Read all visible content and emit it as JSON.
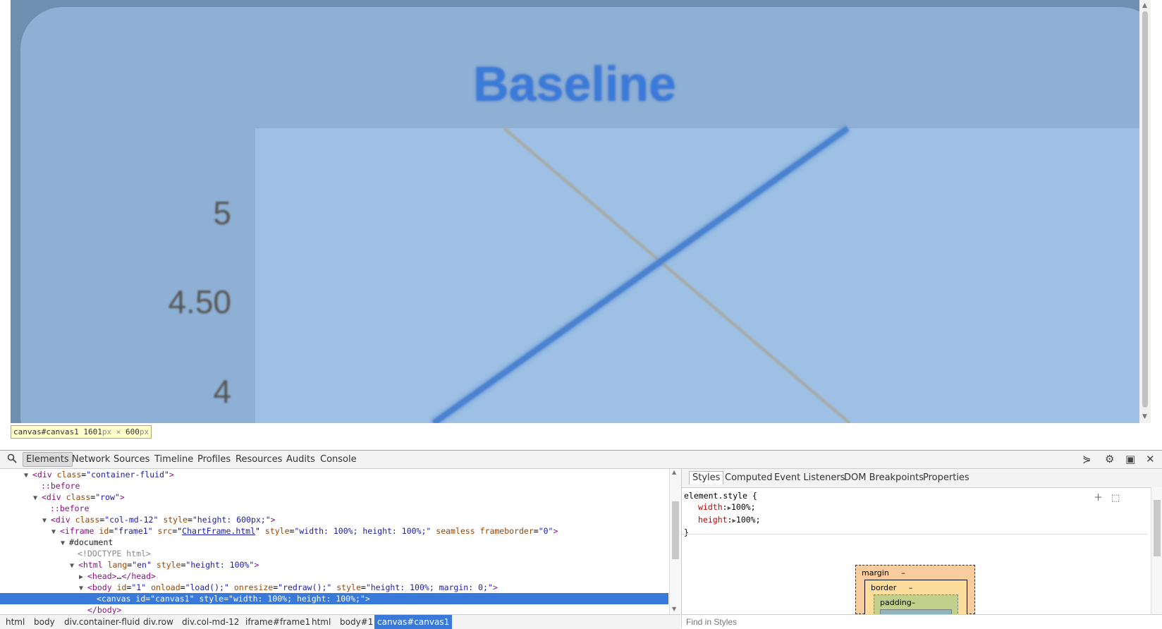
{
  "chart": {
    "title": "Baseline",
    "y_ticks": [
      "5",
      "4.50",
      "4"
    ],
    "colors": {
      "background": "#8eb0d4",
      "plot_fill": "#9dc0e4",
      "title": "#3a7ad8",
      "axis": "#d56b8a",
      "series_blue": "#4a82d0",
      "series_gray": "#a9a8a0"
    }
  },
  "chart_data": {
    "type": "line",
    "title": "Baseline",
    "y_ticks": [
      "5",
      "4.50",
      "4"
    ],
    "series": [
      {
        "values_note": "",
        "color": "#4a82d0"
      },
      {
        "values_note": "",
        "color": "#a9a8a0"
      }
    ]
  },
  "tooltip": {
    "selector": "canvas#canvas1",
    "width": "1601",
    "width_unit": "px",
    "times": "×",
    "height": "600",
    "height_unit": "px"
  },
  "toolbar": {
    "tabs": [
      "Elements",
      "Network",
      "Sources",
      "Timeline",
      "Profiles",
      "Resources",
      "Audits",
      "Console"
    ],
    "active": "Elements"
  },
  "dom": {
    "l1": {
      "tag": "<div",
      "attr": "class",
      "val": "\"container-fluid\"",
      "end": ">"
    },
    "l2": {
      "pseudo": "::before"
    },
    "l3": {
      "tag": "<div",
      "attr": "class",
      "val": "\"row\"",
      "end": ">"
    },
    "l4": {
      "pseudo": "::before"
    },
    "l5": {
      "tag": "<div",
      "attr1": "class",
      "val1": "\"col-md-12\"",
      "attr2": "style",
      "val2": "\"height: 600px;\"",
      "end": ">"
    },
    "l6": {
      "tag": "<iframe",
      "attr1": "id",
      "val1": "\"frame1\"",
      "attr2": "src",
      "val2": "ChartFrame.html",
      "attr3": "style",
      "val3": "\"width: 100%; height: 100%;\"",
      "attr4": "seamless",
      "attr5": "frameborder",
      "val5": "\"0\"",
      "end": ">"
    },
    "l7": {
      "text": "#document"
    },
    "l8": {
      "text": "<!DOCTYPE html>"
    },
    "l9": {
      "tag": "<html",
      "attr1": "lang",
      "val1": "\"en\"",
      "attr2": "style",
      "val2": "\"height: 100%\"",
      "end": ">"
    },
    "l10": {
      "tag": "<head>",
      "mid": "…",
      "close": "</head>"
    },
    "l11": {
      "tag": "<body",
      "attr1": "id",
      "val1": "\"1\"",
      "attr2": "onload",
      "val2": "\"load();\"",
      "attr3": "onresize",
      "val3": "\"redraw();\"",
      "attr4": "style",
      "val4": "\"height: 100%; margin: 0;\"",
      "end": ">"
    },
    "l12": {
      "tag": "<canvas",
      "attr1": "id",
      "val1": "\"canvas1\"",
      "attr2": "style",
      "val2": "\"width: 100%; height: 100%;\"",
      "end": ">"
    },
    "l13": {
      "tag": "</body>"
    }
  },
  "breadcrumbs": [
    "html",
    "body",
    "div.container-fluid",
    "div.row",
    "div.col-md-12",
    "iframe#frame1",
    "html",
    "body#1",
    "canvas#canvas1"
  ],
  "styles": {
    "tabs": [
      "Styles",
      "Computed",
      "Event Listeners",
      "DOM Breakpoints",
      "Properties"
    ],
    "active": "Styles",
    "rule_selector": "element.style {",
    "rule_close": "}",
    "props": [
      {
        "name": "width",
        "value": "100%;"
      },
      {
        "name": "height",
        "value": "100%;"
      }
    ],
    "box_model": {
      "margin": "margin",
      "margin_val": "–",
      "border": "border",
      "border_val": "–",
      "padding": "padding–"
    },
    "find_placeholder": "Find in Styles"
  }
}
